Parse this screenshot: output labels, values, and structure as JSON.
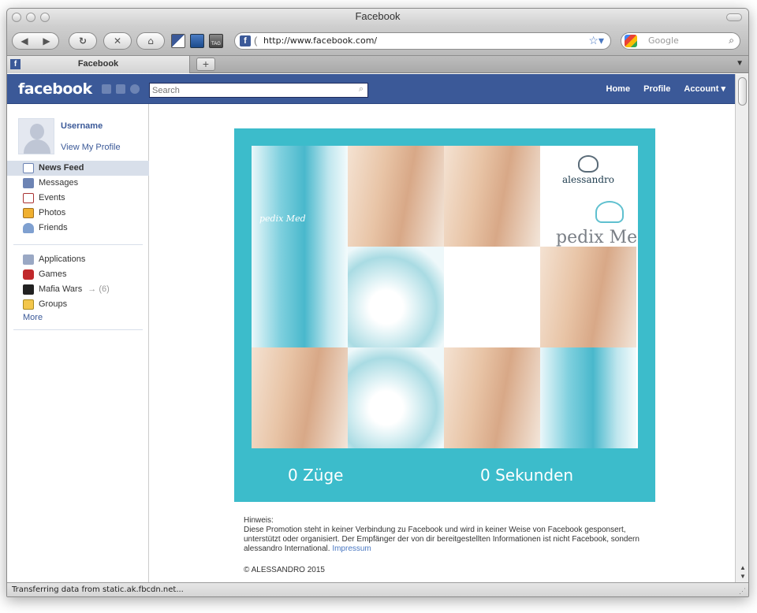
{
  "browser": {
    "window_title": "Facebook",
    "url": "http://www.facebook.com/",
    "search_placeholder": "Google",
    "tab_title": "Facebook",
    "new_tab_label": "+",
    "toolbar_icon_tag": "TAG",
    "status_text": "Transferring data from static.ak.fbcdn.net..."
  },
  "fb_header": {
    "logo": "facebook",
    "search_placeholder": "Search",
    "nav": {
      "home": "Home",
      "profile": "Profile",
      "account": "Account ▾"
    }
  },
  "sidebar": {
    "username": "Username",
    "view_profile": "View My Profile",
    "items": [
      {
        "label": "News Feed",
        "icon": "news-feed-icon"
      },
      {
        "label": "Messages",
        "icon": "messages-icon"
      },
      {
        "label": "Events",
        "icon": "events-icon"
      },
      {
        "label": "Photos",
        "icon": "photos-icon"
      },
      {
        "label": "Friends",
        "icon": "friends-icon"
      }
    ],
    "apps": [
      {
        "label": "Applications",
        "icon": "applications-icon"
      },
      {
        "label": "Games",
        "icon": "games-icon"
      },
      {
        "label": "Mafia Wars",
        "icon": "mafia-wars-icon",
        "count": "(6)"
      },
      {
        "label": "Groups",
        "icon": "groups-icon"
      }
    ],
    "more": "More"
  },
  "promo": {
    "brand": "alessandro",
    "product": "pedix Mec",
    "tube_text": "pedix Med",
    "moves": "0 Züge",
    "seconds": "0 Sekunden",
    "accent_color": "#3cbccb"
  },
  "notice": {
    "heading": "Hinweis:",
    "text": "Diese Promotion steht in keiner Verbindung zu Facebook und wird in keiner Weise von Facebook gesponsert, unterstützt oder organisiert. Der Empfänger der von dir bereitgestellten Informationen ist nicht Facebook, sondern alessandro International.",
    "link": "Impressum",
    "copyright": "© ALESSANDRO 2015"
  }
}
